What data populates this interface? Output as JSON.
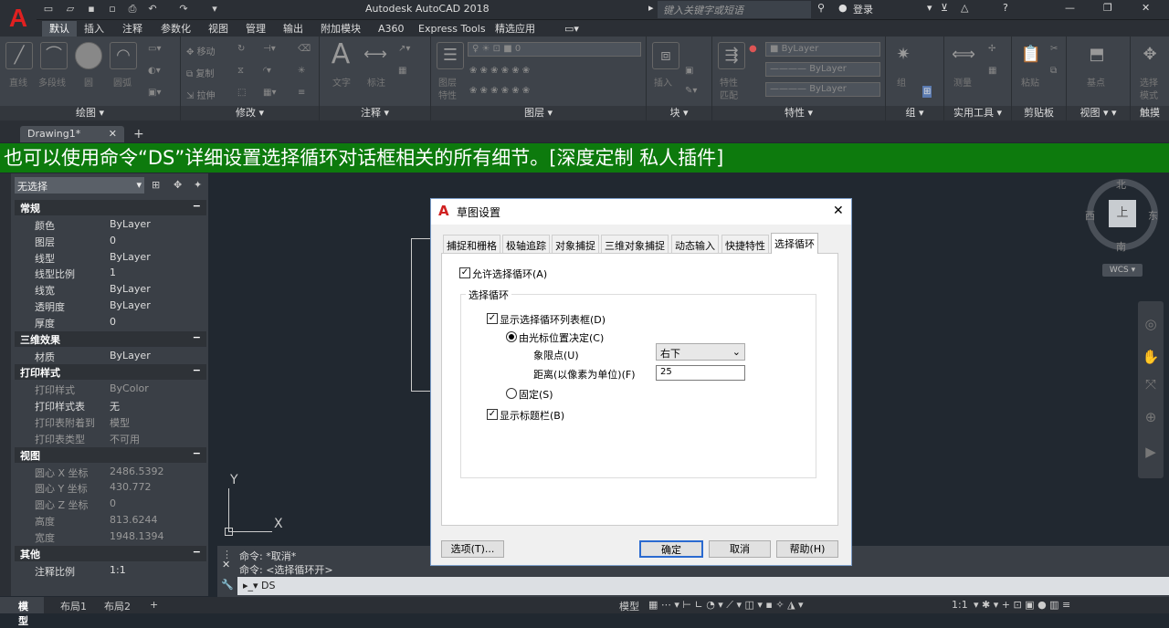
{
  "app": {
    "logo": "A",
    "title": "Autodesk AutoCAD 2018",
    "search_placeholder": "键入关键字或短语",
    "signin": "登录"
  },
  "ribbon_tabs": [
    "默认",
    "插入",
    "注释",
    "参数化",
    "视图",
    "管理",
    "输出",
    "附加模块",
    "A360",
    "Express Tools",
    "精选应用"
  ],
  "ribbon_active_tab": "默认",
  "ribbon_panels": {
    "draw": "绘图",
    "modify": "修改",
    "annotation": "注释",
    "layers": "图层",
    "block": "块",
    "properties": "特性",
    "groups": "组",
    "utilities": "实用工具",
    "clipboard": "剪贴板",
    "view": "视图",
    "touch": "触摸"
  },
  "ribbon_items": {
    "draw": [
      "直线",
      "多段线",
      "圆",
      "圆弧"
    ],
    "modify": [
      "移动",
      "旋转",
      "修剪",
      "复制",
      "镜像",
      "圆角",
      "拉伸",
      "缩放",
      "阵列"
    ],
    "annotation": [
      "文字",
      "标注"
    ],
    "layers_label": [
      "图层",
      "特性"
    ],
    "layer_combo": "0",
    "insert": "插入",
    "match": [
      "特性",
      "匹配"
    ],
    "bylayer": "ByLayer",
    "groups": "组",
    "measure": "测量",
    "paste": "粘贴",
    "base": "基点",
    "select_mode": [
      "选择",
      "模式"
    ]
  },
  "document": {
    "tab": "Drawing1*",
    "add": "+"
  },
  "caption": "也可以使用命令“DS”详细设置选择循环对话框相关的所有细节。[深度定制 私人插件]",
  "properties": {
    "selection": "无选择",
    "sections": [
      {
        "title": "常规",
        "rows": [
          [
            "颜色",
            "ByLayer"
          ],
          [
            "图层",
            "0"
          ],
          [
            "线型",
            "ByLayer"
          ],
          [
            "线型比例",
            "1"
          ],
          [
            "线宽",
            "ByLayer"
          ],
          [
            "透明度",
            "ByLayer"
          ],
          [
            "厚度",
            "0"
          ]
        ]
      },
      {
        "title": "三维效果",
        "rows": [
          [
            "材质",
            "ByLayer"
          ]
        ]
      },
      {
        "title": "打印样式",
        "rows": [
          [
            "打印样式",
            "ByColor"
          ],
          [
            "打印样式表",
            "无"
          ],
          [
            "打印表附着到",
            "模型"
          ],
          [
            "打印表类型",
            "不可用"
          ]
        ]
      },
      {
        "title": "视图",
        "rows": [
          [
            "圆心 X 坐标",
            "2486.5392"
          ],
          [
            "圆心 Y 坐标",
            "430.772"
          ],
          [
            "圆心 Z 坐标",
            "0"
          ],
          [
            "高度",
            "813.6244"
          ],
          [
            "宽度",
            "1948.1394"
          ]
        ]
      },
      {
        "title": "其他",
        "rows": [
          [
            "注释比例",
            "1:1"
          ]
        ]
      }
    ],
    "collapse": "−"
  },
  "viewcube": {
    "north": "北",
    "south": "南",
    "east": "东",
    "west": "西",
    "center": "上",
    "wcs": "WCS"
  },
  "ucs": {
    "x": "X",
    "y": "Y"
  },
  "command": {
    "history": [
      "命令: *取消*",
      "命令: <选择循环开>"
    ],
    "input": "DS"
  },
  "layout_tabs": [
    "模型",
    "布局1",
    "布局2",
    "+"
  ],
  "status_model": "模型",
  "status_scale": "1:1",
  "dialog": {
    "title": "草图设置",
    "close": "✕",
    "tabs": [
      "捕捉和栅格",
      "极轴追踪",
      "对象捕捉",
      "三维对象捕捉",
      "动态输入",
      "快捷特性",
      "选择循环"
    ],
    "active_tab": "选择循环",
    "allow_cycling": "允许选择循环(A)",
    "group_title": "选择循环",
    "show_list": "显示选择循环列表框(D)",
    "by_cursor": "由光标位置决定(C)",
    "quadrant_label": "象限点(U)",
    "quadrant_value": "右下",
    "distance_label": "距离(以像素为单位)(F)",
    "distance_value": "25",
    "fixed": "固定(S)",
    "show_titlebar": "显示标题栏(B)",
    "options_button": "选项(T)...",
    "ok_button": "确定",
    "cancel_button": "取消",
    "help_button": "帮助(H)"
  }
}
